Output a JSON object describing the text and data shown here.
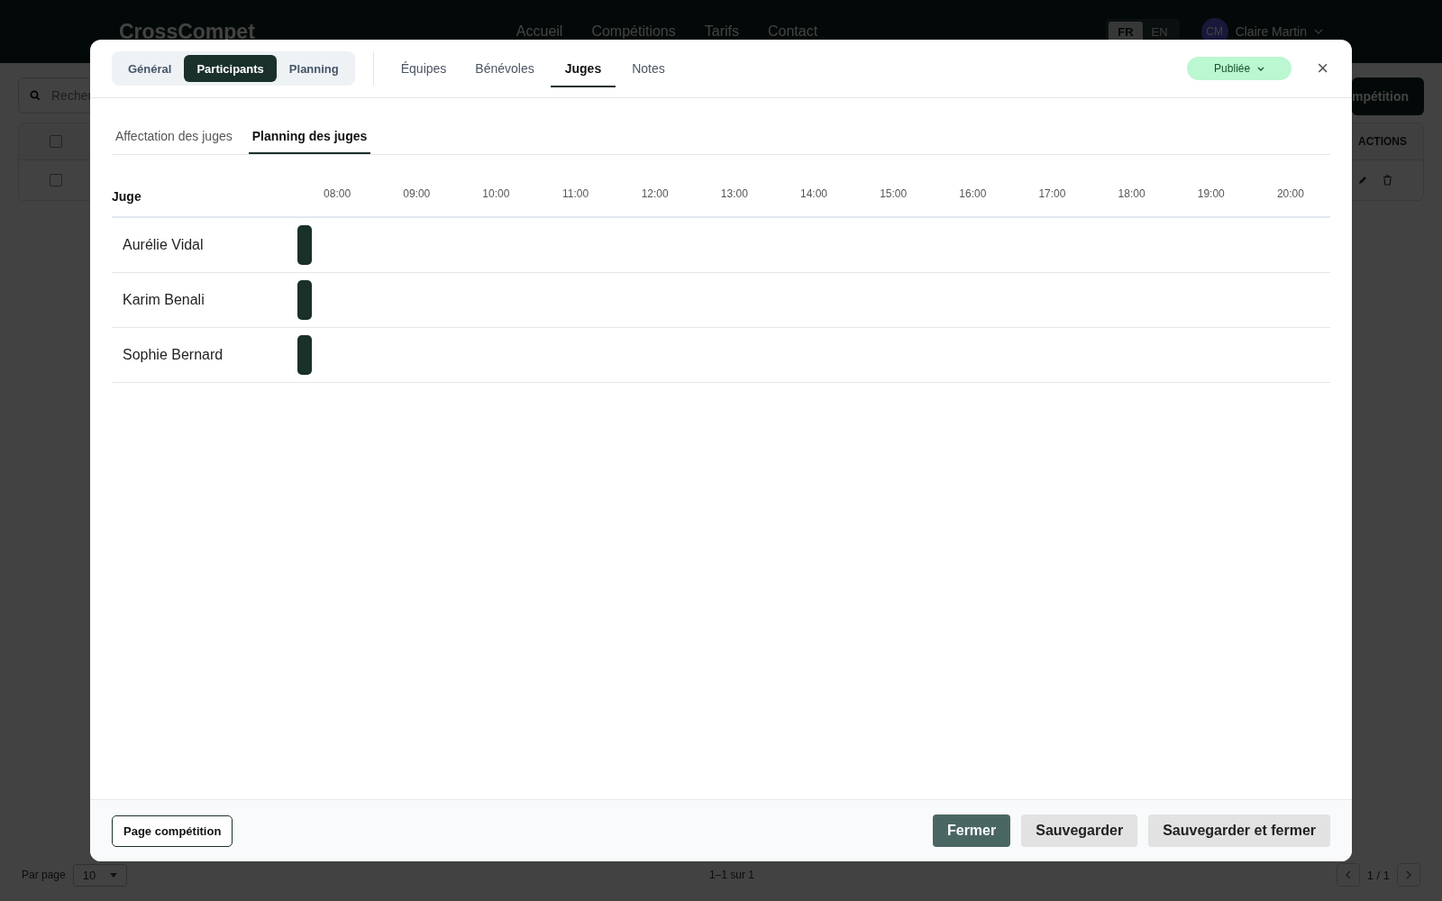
{
  "background": {
    "logo": "CrossCompet",
    "nav": [
      "Accueil",
      "Compétitions",
      "Tarifs",
      "Contact"
    ],
    "languages": [
      {
        "label": "FR",
        "selected": true
      },
      {
        "label": "EN",
        "selected": false
      }
    ],
    "user": {
      "initials": "CM",
      "name": "Claire Martin"
    },
    "search": {
      "placeholder": "Recher"
    },
    "new_button": "mpétition",
    "table": {
      "actions_header": "ACTIONS",
      "header_checkbox": {
        "checked": false
      },
      "rows": [
        {
          "checked": false
        }
      ]
    },
    "pagination": {
      "per_page_label": "Par page",
      "per_page": "10",
      "range": "1–1 sur 1",
      "page": "1 / 1"
    }
  },
  "modal": {
    "section_tabs": [
      {
        "label": "Général",
        "selected": false
      },
      {
        "label": "Participants",
        "selected": true
      },
      {
        "label": "Planning",
        "selected": false
      }
    ],
    "tabs": [
      {
        "label": "Équipes",
        "selected": false
      },
      {
        "label": "Bénévoles",
        "selected": false
      },
      {
        "label": "Juges",
        "selected": true
      },
      {
        "label": "Notes",
        "selected": false
      }
    ],
    "status": "Publiée",
    "close": "×",
    "sub_tabs": [
      {
        "label": "Affectation des juges",
        "selected": false
      },
      {
        "label": "Planning des juges",
        "selected": true
      }
    ],
    "schedule": {
      "header": "Juge",
      "hours": [
        "08:00",
        "09:00",
        "10:00",
        "11:00",
        "12:00",
        "13:00",
        "14:00",
        "15:00",
        "16:00",
        "17:00",
        "18:00",
        "19:00",
        "20:00"
      ],
      "judges": [
        {
          "name": "Aurélie Vidal"
        },
        {
          "name": "Karim Benali"
        },
        {
          "name": "Sophie Bernard"
        }
      ]
    },
    "footer": {
      "page_button": "Page compétition",
      "buttons": [
        {
          "label": "Fermer",
          "kind": "primary"
        },
        {
          "label": "Sauvegarder",
          "kind": "secondary"
        },
        {
          "label": "Sauvegarder et fermer",
          "kind": "secondary"
        }
      ]
    }
  }
}
